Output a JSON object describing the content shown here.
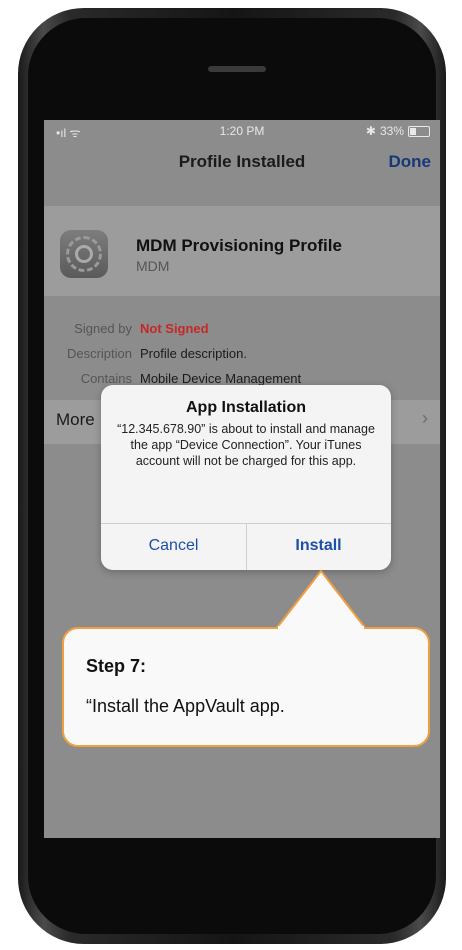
{
  "status_bar": {
    "time": "1:20 PM",
    "battery": "33%",
    "battery_level": 0.33
  },
  "nav": {
    "title": "Profile Installed",
    "done_label": "Done"
  },
  "profile": {
    "icon": "gear-icon",
    "name": "MDM Provisioning Profile",
    "subtitle": "MDM",
    "details": [
      {
        "label": "Signed by",
        "value": "Not Signed",
        "value_color": "#c62828"
      },
      {
        "label": "Description",
        "value": "Profile description."
      },
      {
        "label": "Contains",
        "value": "Mobile Device Management"
      }
    ]
  },
  "more_row": {
    "label": "More"
  },
  "alert": {
    "title": "App Installation",
    "message": "“12.345.678.90” is about to install and manage the app “Device Connection”. Your iTunes account will not be charged for this app.",
    "cancel_label": "Cancel",
    "install_label": "Install"
  },
  "callout": {
    "step": "Step 7:",
    "text": "“Install the AppVault app.",
    "border_color": "#f0a040"
  }
}
